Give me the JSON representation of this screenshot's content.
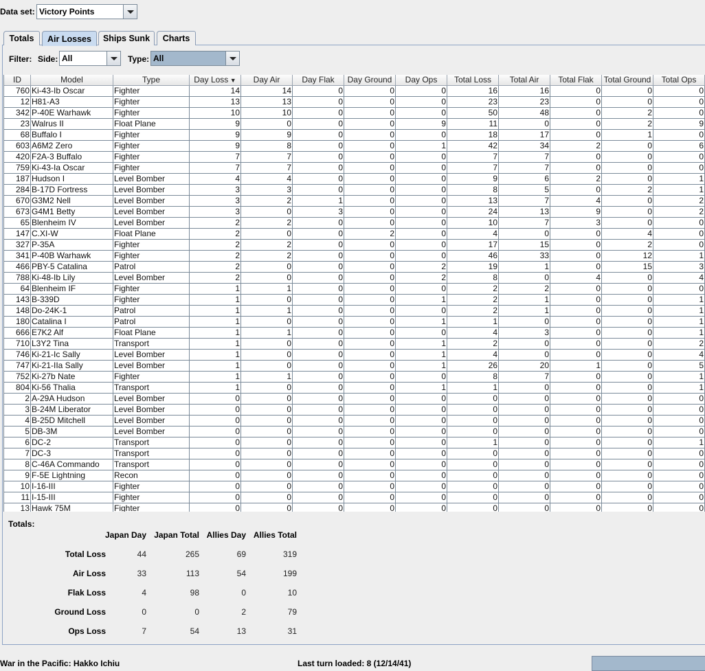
{
  "dataset": {
    "label": "Data set:",
    "value": "Victory Points"
  },
  "tabs": [
    {
      "label": "Totals"
    },
    {
      "label": "Air Losses"
    },
    {
      "label": "Ships Sunk"
    },
    {
      "label": "Charts"
    }
  ],
  "filter": {
    "label": "Filter:",
    "side_label": "Side:",
    "side_value": "All",
    "type_label": "Type:",
    "type_value": "All"
  },
  "table": {
    "columns": [
      "ID",
      "Model",
      "Type",
      "Day Loss",
      "Day Air",
      "Day Flak",
      "Day Ground",
      "Day Ops",
      "Total Loss",
      "Total Air",
      "Total Flak",
      "Total Ground",
      "Total Ops"
    ],
    "sorted_column": "Day Loss",
    "rows": [
      [
        "760",
        "Ki-43-Ib Oscar",
        "Fighter",
        "14",
        "14",
        "0",
        "0",
        "0",
        "16",
        "16",
        "0",
        "0",
        "0"
      ],
      [
        "12",
        "H81-A3",
        "Fighter",
        "13",
        "13",
        "0",
        "0",
        "0",
        "23",
        "23",
        "0",
        "0",
        "0"
      ],
      [
        "342",
        "P-40E Warhawk",
        "Fighter",
        "10",
        "10",
        "0",
        "0",
        "0",
        "50",
        "48",
        "0",
        "2",
        "0"
      ],
      [
        "23",
        "Walrus II",
        "Float Plane",
        "9",
        "0",
        "0",
        "0",
        "9",
        "11",
        "0",
        "0",
        "2",
        "9"
      ],
      [
        "68",
        "Buffalo I",
        "Fighter",
        "9",
        "9",
        "0",
        "0",
        "0",
        "18",
        "17",
        "0",
        "1",
        "0"
      ],
      [
        "603",
        "A6M2 Zero",
        "Fighter",
        "9",
        "8",
        "0",
        "0",
        "1",
        "42",
        "34",
        "2",
        "0",
        "6"
      ],
      [
        "420",
        "F2A-3 Buffalo",
        "Fighter",
        "7",
        "7",
        "0",
        "0",
        "0",
        "7",
        "7",
        "0",
        "0",
        "0"
      ],
      [
        "759",
        "Ki-43-Ia Oscar",
        "Fighter",
        "7",
        "7",
        "0",
        "0",
        "0",
        "7",
        "7",
        "0",
        "0",
        "0"
      ],
      [
        "187",
        "Hudson I",
        "Level Bomber",
        "4",
        "4",
        "0",
        "0",
        "0",
        "9",
        "6",
        "2",
        "0",
        "1"
      ],
      [
        "284",
        "B-17D Fortress",
        "Level Bomber",
        "3",
        "3",
        "0",
        "0",
        "0",
        "8",
        "5",
        "0",
        "2",
        "1"
      ],
      [
        "670",
        "G3M2 Nell",
        "Level Bomber",
        "3",
        "2",
        "1",
        "0",
        "0",
        "13",
        "7",
        "4",
        "0",
        "2"
      ],
      [
        "673",
        "G4M1 Betty",
        "Level Bomber",
        "3",
        "0",
        "3",
        "0",
        "0",
        "24",
        "13",
        "9",
        "0",
        "2"
      ],
      [
        "65",
        "Blenheim IV",
        "Level Bomber",
        "2",
        "2",
        "0",
        "0",
        "0",
        "10",
        "7",
        "3",
        "0",
        "0"
      ],
      [
        "147",
        "C.XI-W",
        "Float Plane",
        "2",
        "0",
        "0",
        "2",
        "0",
        "4",
        "0",
        "0",
        "4",
        "0"
      ],
      [
        "327",
        "P-35A",
        "Fighter",
        "2",
        "2",
        "0",
        "0",
        "0",
        "17",
        "15",
        "0",
        "2",
        "0"
      ],
      [
        "341",
        "P-40B Warhawk",
        "Fighter",
        "2",
        "2",
        "0",
        "0",
        "0",
        "46",
        "33",
        "0",
        "12",
        "1"
      ],
      [
        "466",
        "PBY-5 Catalina",
        "Patrol",
        "2",
        "0",
        "0",
        "0",
        "2",
        "19",
        "1",
        "0",
        "15",
        "3"
      ],
      [
        "788",
        "Ki-48-Ib Lily",
        "Level Bomber",
        "2",
        "0",
        "0",
        "0",
        "2",
        "8",
        "0",
        "4",
        "0",
        "4"
      ],
      [
        "64",
        "Blenheim IF",
        "Fighter",
        "1",
        "1",
        "0",
        "0",
        "0",
        "2",
        "2",
        "0",
        "0",
        "0"
      ],
      [
        "143",
        "B-339D",
        "Fighter",
        "1",
        "0",
        "0",
        "0",
        "1",
        "2",
        "1",
        "0",
        "0",
        "1"
      ],
      [
        "148",
        "Do-24K-1",
        "Patrol",
        "1",
        "1",
        "0",
        "0",
        "0",
        "2",
        "1",
        "0",
        "0",
        "1"
      ],
      [
        "180",
        "Catalina I",
        "Patrol",
        "1",
        "0",
        "0",
        "0",
        "1",
        "1",
        "0",
        "0",
        "0",
        "1"
      ],
      [
        "666",
        "E7K2 Alf",
        "Float Plane",
        "1",
        "1",
        "0",
        "0",
        "0",
        "4",
        "3",
        "0",
        "0",
        "1"
      ],
      [
        "710",
        "L3Y2 Tina",
        "Transport",
        "1",
        "0",
        "0",
        "0",
        "1",
        "2",
        "0",
        "0",
        "0",
        "2"
      ],
      [
        "746",
        "Ki-21-Ic Sally",
        "Level Bomber",
        "1",
        "0",
        "0",
        "0",
        "1",
        "4",
        "0",
        "0",
        "0",
        "4"
      ],
      [
        "747",
        "Ki-21-IIa Sally",
        "Level Bomber",
        "1",
        "0",
        "0",
        "0",
        "1",
        "26",
        "20",
        "1",
        "0",
        "5"
      ],
      [
        "752",
        "Ki-27b Nate",
        "Fighter",
        "1",
        "1",
        "0",
        "0",
        "0",
        "8",
        "7",
        "0",
        "0",
        "1"
      ],
      [
        "804",
        "Ki-56 Thalia",
        "Transport",
        "1",
        "0",
        "0",
        "0",
        "1",
        "1",
        "0",
        "0",
        "0",
        "1"
      ],
      [
        "2",
        "A-29A Hudson",
        "Level Bomber",
        "0",
        "0",
        "0",
        "0",
        "0",
        "0",
        "0",
        "0",
        "0",
        "0"
      ],
      [
        "3",
        "B-24M Liberator",
        "Level Bomber",
        "0",
        "0",
        "0",
        "0",
        "0",
        "0",
        "0",
        "0",
        "0",
        "0"
      ],
      [
        "4",
        "B-25D Mitchell",
        "Level Bomber",
        "0",
        "0",
        "0",
        "0",
        "0",
        "0",
        "0",
        "0",
        "0",
        "0"
      ],
      [
        "5",
        "DB-3M",
        "Level Bomber",
        "0",
        "0",
        "0",
        "0",
        "0",
        "0",
        "0",
        "0",
        "0",
        "0"
      ],
      [
        "6",
        "DC-2",
        "Transport",
        "0",
        "0",
        "0",
        "0",
        "0",
        "1",
        "0",
        "0",
        "0",
        "1"
      ],
      [
        "7",
        "DC-3",
        "Transport",
        "0",
        "0",
        "0",
        "0",
        "0",
        "0",
        "0",
        "0",
        "0",
        "0"
      ],
      [
        "8",
        "C-46A Commando",
        "Transport",
        "0",
        "0",
        "0",
        "0",
        "0",
        "0",
        "0",
        "0",
        "0",
        "0"
      ],
      [
        "9",
        "F-5E Lightning",
        "Recon",
        "0",
        "0",
        "0",
        "0",
        "0",
        "0",
        "0",
        "0",
        "0",
        "0"
      ],
      [
        "10",
        "I-16-III",
        "Fighter",
        "0",
        "0",
        "0",
        "0",
        "0",
        "0",
        "0",
        "0",
        "0",
        "0"
      ],
      [
        "11",
        "I-15-III",
        "Fighter",
        "0",
        "0",
        "0",
        "0",
        "0",
        "0",
        "0",
        "0",
        "0",
        "0"
      ],
      [
        "13",
        "Hawk 75M",
        "Fighter",
        "0",
        "0",
        "0",
        "0",
        "0",
        "0",
        "0",
        "0",
        "0",
        "0"
      ]
    ]
  },
  "totals": {
    "label": "Totals:",
    "columns": [
      "Japan Day",
      "Japan Total",
      "Allies Day",
      "Allies Total"
    ],
    "rows": [
      {
        "label": "Total Loss",
        "values": [
          "44",
          "265",
          "69",
          "319"
        ]
      },
      {
        "label": "Air Loss",
        "values": [
          "33",
          "113",
          "54",
          "199"
        ]
      },
      {
        "label": "Flak Loss",
        "values": [
          "4",
          "98",
          "0",
          "10"
        ]
      },
      {
        "label": "Ground Loss",
        "values": [
          "0",
          "0",
          "2",
          "79"
        ]
      },
      {
        "label": "Ops Loss",
        "values": [
          "7",
          "54",
          "13",
          "31"
        ]
      }
    ]
  },
  "status": {
    "app_title": "War in the Pacific: Hakko Ichiu",
    "last_turn": "Last turn loaded: 8 (12/14/41)"
  },
  "colors": {
    "accent": "#c9dbf0",
    "selected_combo": "#a3b8cc",
    "grid": "#7a8a99"
  }
}
